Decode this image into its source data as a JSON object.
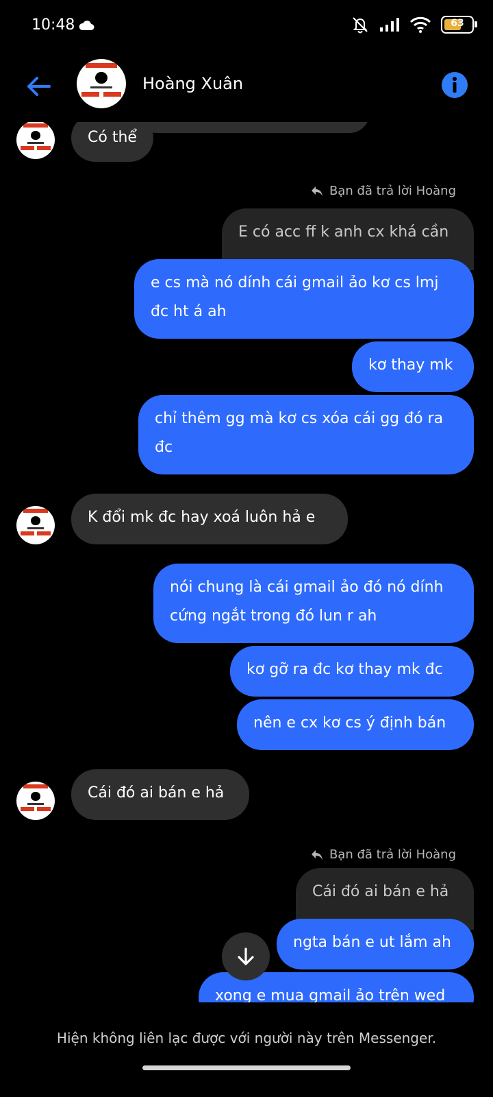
{
  "status_bar": {
    "time": "10:48",
    "battery": "63",
    "battery_level": 0.63
  },
  "header": {
    "contact_name": "Hoàng Xuân",
    "avatar_caption": "Hoàng Xuân"
  },
  "messages": [
    {
      "side": "in",
      "text": "Có thể"
    },
    {
      "reply_label": "Bạn đã trả lời Hoàng",
      "quoted": "E có acc ff k anh cx khá cần"
    },
    {
      "side": "out",
      "text": "e cs mà nó dính cái gmail ảo kơ cs lmj đc ht á ah"
    },
    {
      "side": "out",
      "text": "kơ thay mk"
    },
    {
      "side": "out",
      "text": "chỉ thêm gg mà kơ cs xóa cái gg đó ra đc"
    },
    {
      "side": "in",
      "text": "K đổi mk đc hay xoá luôn hả e"
    },
    {
      "side": "out",
      "text": "nói chung là cái gmail ảo đó nó dính cứng ngắt trong đó lun r ah"
    },
    {
      "side": "out",
      "text": "kơ gỡ ra đc kơ thay mk đc"
    },
    {
      "side": "out",
      "text": "nên e cx kơ cs ý định bán"
    },
    {
      "side": "in",
      "text": "Cái đó ai bán e hả"
    },
    {
      "reply_label": "Bạn đã trả lời Hoàng",
      "quoted": "Cái đó ai bán e hả"
    },
    {
      "side": "out",
      "text": "ngta bán e ut lắm ah"
    },
    {
      "side": "out",
      "text": "xong e mua gmail ảo trên wed"
    }
  ],
  "footer": {
    "notice": "Hiện không liên lạc được với người này trên Messenger."
  },
  "colors": {
    "outgoing_bubble": "#2e6bfd",
    "incoming_bubble": "#2f2f2f",
    "accent": "#2f7cf6"
  },
  "icons": {
    "back": "arrow-left-icon",
    "info": "info-icon",
    "scroll_down": "arrow-down-icon",
    "reply": "reply-icon"
  }
}
